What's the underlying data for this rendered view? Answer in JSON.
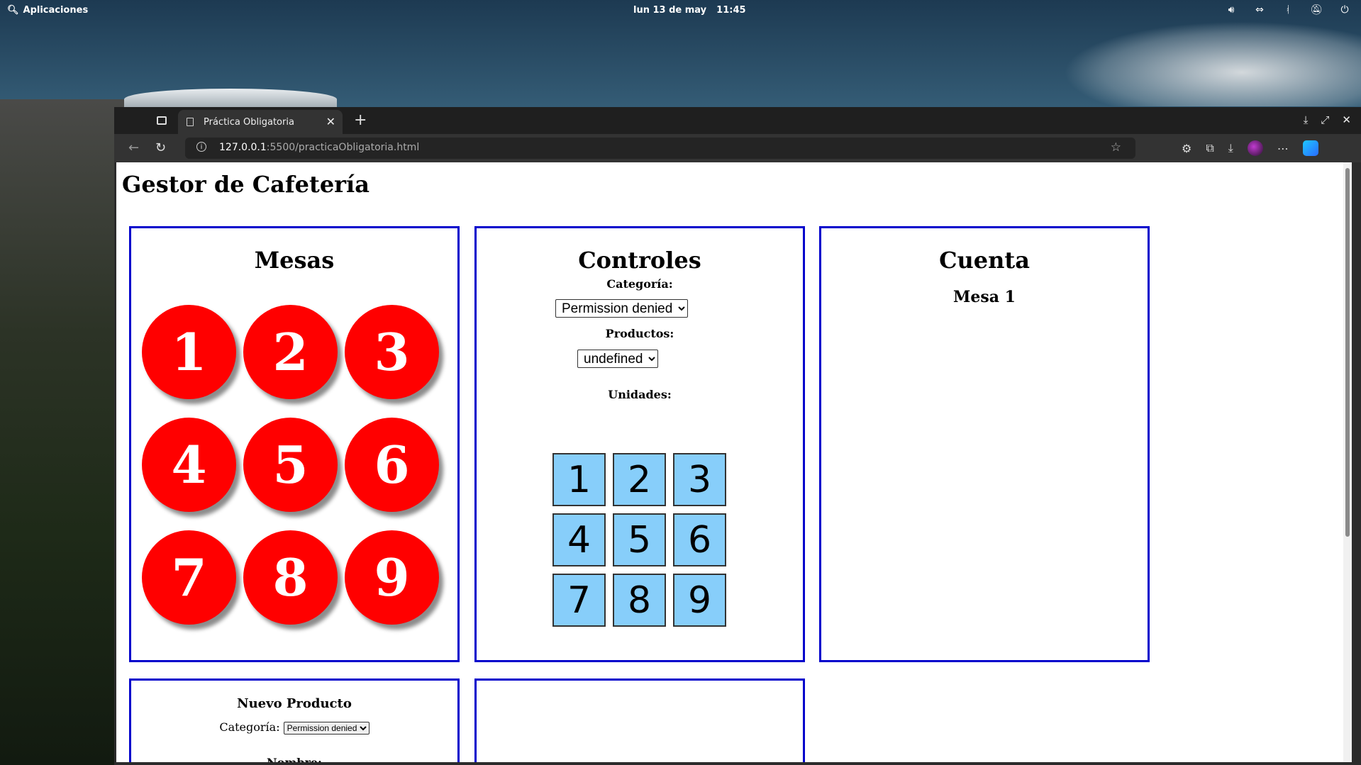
{
  "desktop": {
    "apps_label": "Aplicaciones",
    "date": "lun 13 de may",
    "time": "11:45"
  },
  "browser": {
    "tab_title": "Práctica Obligatoria",
    "url_host": "127.0.0.1",
    "url_rest": ":5500/practicaObligatoria.html"
  },
  "page": {
    "title": "Gestor de Cafetería",
    "mesas": {
      "heading": "Mesas",
      "tables": [
        "1",
        "2",
        "3",
        "4",
        "5",
        "6",
        "7",
        "8",
        "9"
      ]
    },
    "controles": {
      "heading": "Controles",
      "categoria_label": "Categoría:",
      "categoria_value": "Permission denied",
      "productos_label": "Productos:",
      "productos_value": "undefined",
      "unidades_label": "Unidades:",
      "units": [
        "1",
        "2",
        "3",
        "4",
        "5",
        "6",
        "7",
        "8",
        "9"
      ]
    },
    "cuenta": {
      "heading": "Cuenta",
      "mesa_label": "Mesa 1"
    },
    "nuevo_producto": {
      "heading": "Nuevo Producto",
      "categoria_label": "Categoría:",
      "categoria_value": "Permission denied",
      "nombre_label": "Nombre:"
    }
  }
}
